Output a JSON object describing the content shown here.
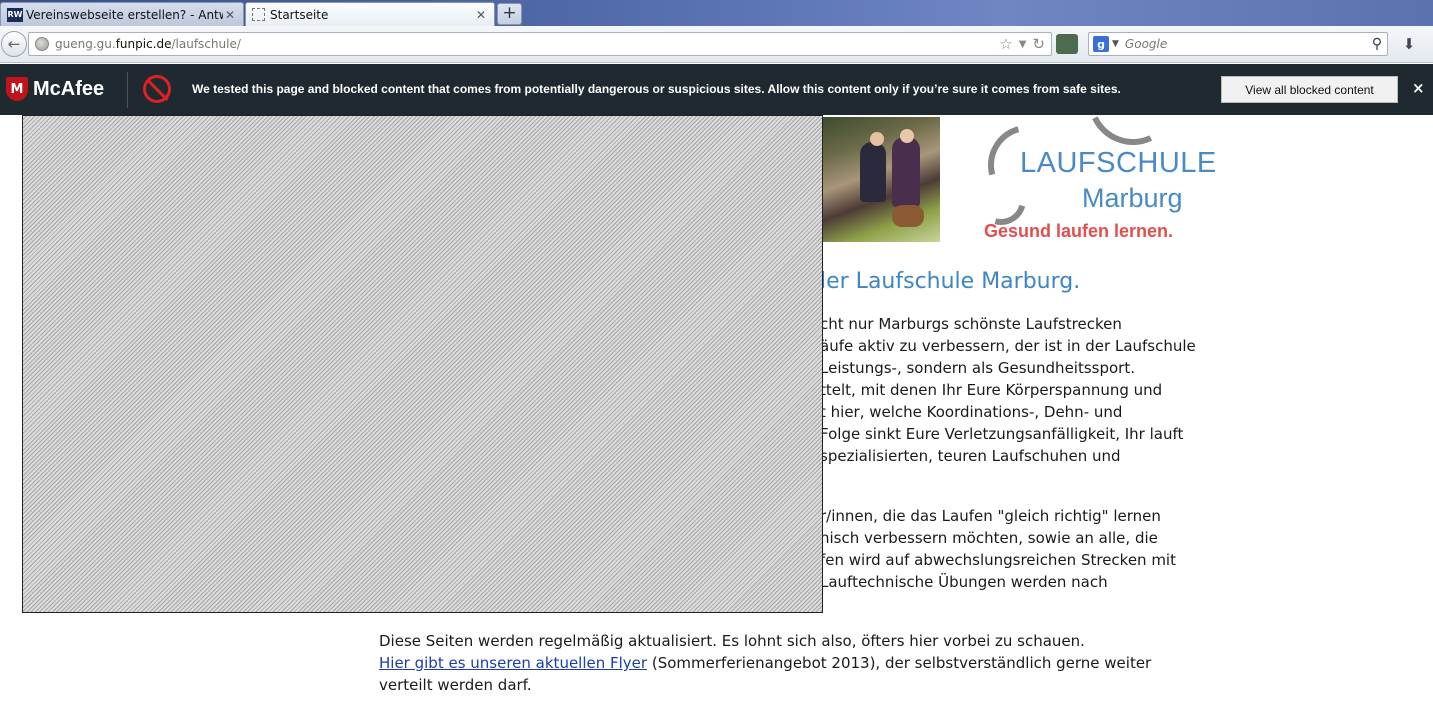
{
  "browser": {
    "tabs": [
      {
        "label": "Vereinswebseite erstellen? - Antworten",
        "favicon": "RW",
        "active": false
      },
      {
        "label": "Startseite",
        "active": true
      }
    ],
    "close_glyph": "✕",
    "new_tab_glyph": "+",
    "url": {
      "prefix": "gueng.gu.",
      "host": "funpic.de",
      "path": "/laufschule/"
    },
    "search_engine_letter": "g",
    "search_placeholder": "Google"
  },
  "mcafee": {
    "brand": "McAfee",
    "message": "We tested this page and blocked content that comes from potentially dangerous or suspicious sites. Allow this content only if you’re sure it comes from safe sites.",
    "button_label": "View all blocked content",
    "close_glyph": "×",
    "colors": {
      "bar": "#1e2a2f",
      "shield": "#c0141c",
      "block": "#e02020"
    }
  },
  "page": {
    "logo": {
      "line1": "LAUFSCHULE",
      "line2": "Marburg",
      "tagline": "Gesund laufen lernen.",
      "colors": {
        "blue": "#4a8ac4",
        "red": "#e24f4f",
        "grey": "#888888"
      }
    },
    "heading": "ler Laufschule Marburg.",
    "paragraph1": [
      "cht nur Marburgs schönste Laufstrecken",
      "äufe aktiv zu verbessern, der ist in der Laufschule",
      "Leistungs-, sondern als Gesundheitssport.",
      "ttelt, mit denen Ihr Eure Körperspannung und",
      "t hier, welche Koordinations-, Dehn- und",
      "Folge sinkt Eure Verletzungsanfälligkeit, Ihr lauft",
      "spezialisierten, teuren Laufschuhen und"
    ],
    "paragraph2": [
      "r/innen, die das Laufen \"gleich richtig\" lernen",
      "nisch verbessern möchten, sowie an alle, die",
      "fen wird auf abwechslungsreichen Strecken mit",
      "Lauftechnische Übungen werden nach"
    ],
    "bottom": {
      "line1": "Diese Seiten werden regelmäßig aktualisiert. Es lohnt sich also, öfters hier vorbei zu schauen.",
      "link": "Hier gibt es unseren aktuellen Flyer",
      "after_link": " (Sommerferienangebot 2013), der selbstverständlich gerne weiter",
      "line3": "verteilt werden darf."
    }
  }
}
